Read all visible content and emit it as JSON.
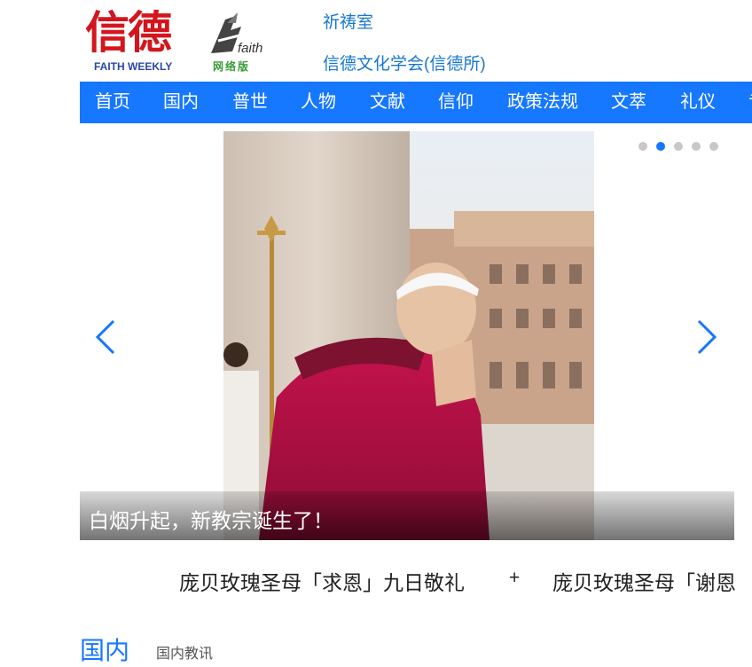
{
  "header": {
    "logo_glyph": "信德",
    "logo_subtitle": "FAITH WEEKLY",
    "faith_word": "faith",
    "faith_net": "网络版",
    "links": [
      "祈祷室",
      "信德文化学会(信德所)"
    ]
  },
  "nav": {
    "items": [
      "首页",
      "国内",
      "普世",
      "人物",
      "文献",
      "信仰",
      "政策法规",
      "文萃",
      "礼仪",
      "专"
    ]
  },
  "carousel": {
    "caption": "白烟升起，新教宗诞生了！",
    "dot_count": 5,
    "active_dot": 2
  },
  "ticker": {
    "items": [
      "庞贝玫瑰圣母「求恩」九日敬礼",
      "庞贝玫瑰圣母「谢恩"
    ],
    "separator": "+"
  },
  "section": {
    "title": "国内",
    "subtitle": "国内教讯"
  },
  "colors": {
    "nav_bg": "#1677ff",
    "link": "#1677d2",
    "logo_red": "#d3161e",
    "logo_blue": "#2a47a8"
  }
}
